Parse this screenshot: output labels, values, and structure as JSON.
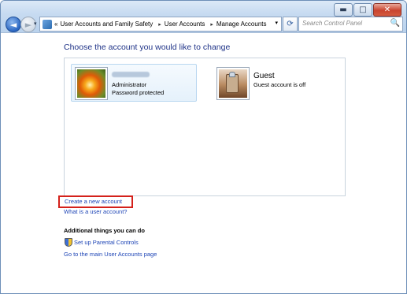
{
  "window": {
    "buttons": {
      "minimize": "▬",
      "maximize": "□",
      "close": "✕"
    }
  },
  "nav": {
    "back": "◄",
    "forward": "►",
    "dropdown": "▾"
  },
  "address": {
    "prefix": "«",
    "crumbs": [
      "User Accounts and Family Safety",
      "User Accounts",
      "Manage Accounts"
    ],
    "separator": "▸",
    "dropdown": "▾"
  },
  "refresh": "⟳",
  "search": {
    "placeholder": "Search Control Panel",
    "icon": "🔍"
  },
  "main": {
    "heading": "Choose the account you would like to change",
    "accounts": [
      {
        "name": "",
        "line1": "Administrator",
        "line2": "Password protected",
        "icon": "flower-avatar",
        "selected": true
      },
      {
        "name": "Guest",
        "line1": "Guest account is off",
        "line2": "",
        "icon": "briefcase-avatar",
        "selected": false
      }
    ],
    "links": {
      "create": "Create a new account",
      "what_is": "What is a user account?"
    },
    "additional": {
      "title": "Additional things you can do",
      "parental": "Set up Parental Controls",
      "main_page": "Go to the main User Accounts page"
    }
  },
  "colors": {
    "link": "#1e45b6",
    "heading": "#1e3287",
    "highlight": "#d4211b"
  }
}
